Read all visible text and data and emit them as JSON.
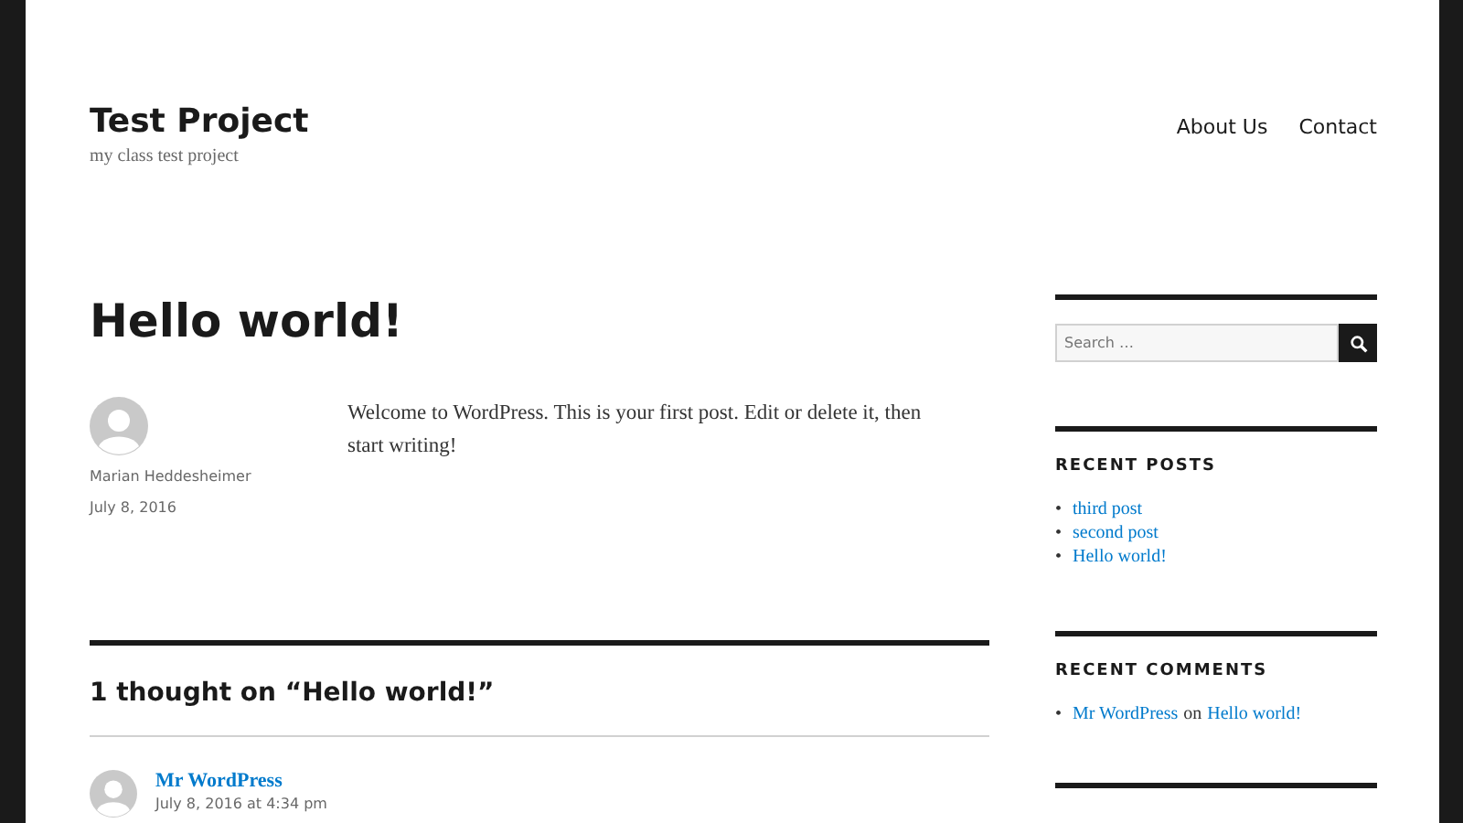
{
  "site": {
    "title": "Test Project",
    "tagline": "my class test project"
  },
  "nav": [
    "About Us",
    "Contact"
  ],
  "post": {
    "title": "Hello world!",
    "author": "Marian Heddesheimer",
    "date": "July 8, 2016",
    "body": "Welcome to WordPress. This is your first post. Edit or delete it, then start writing!"
  },
  "comments": {
    "heading": "1 thought on “Hello world!”",
    "items": [
      {
        "author": "Mr WordPress",
        "date": "July 8, 2016 at 4:34 pm"
      }
    ]
  },
  "sidebar": {
    "search": {
      "placeholder": "Search …"
    },
    "recent_posts": {
      "heading": "RECENT POSTS",
      "marker": "•",
      "items": [
        "third post",
        "second post",
        "Hello world!"
      ]
    },
    "recent_comments": {
      "heading": "RECENT COMMENTS",
      "marker": "•",
      "items": [
        {
          "author": "Mr WordPress",
          "connector": "on",
          "post": "Hello world!"
        }
      ]
    }
  }
}
